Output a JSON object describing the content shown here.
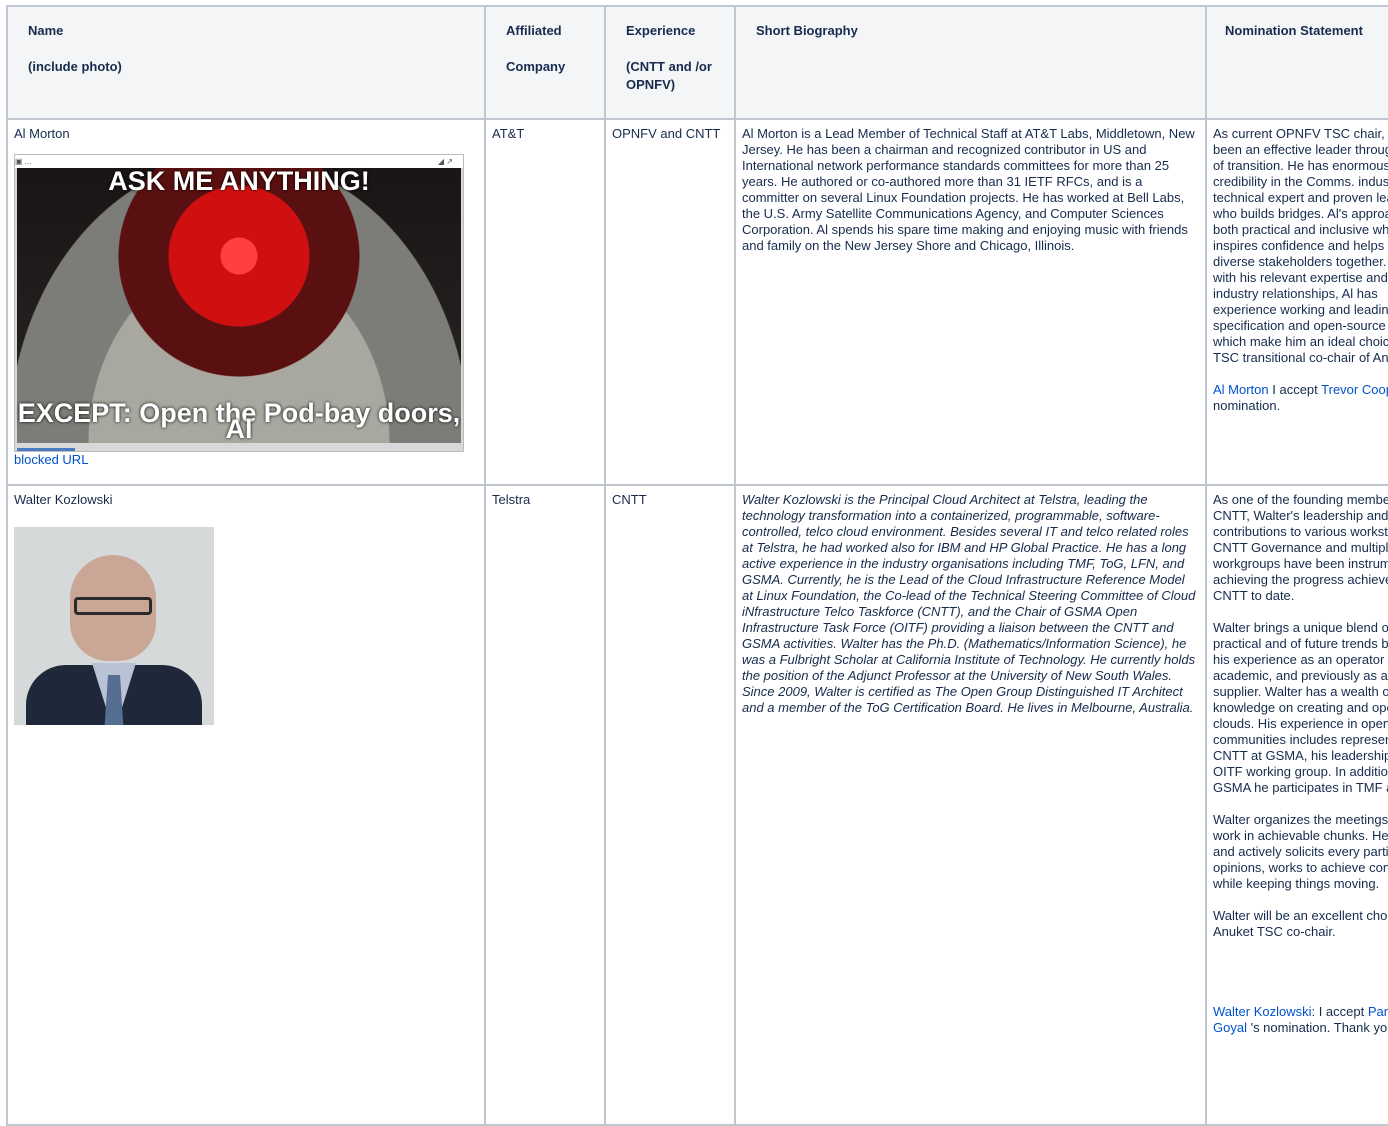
{
  "headers": {
    "name": [
      "Name",
      "(include photo)"
    ],
    "company": [
      "Affiliated",
      "Company"
    ],
    "experience": [
      "Experience",
      "(CNTT and /or OPNFV)"
    ],
    "bio": [
      "Short Biography"
    ],
    "nomination": [
      "Nomination Statement"
    ]
  },
  "rows": [
    {
      "name": "Al Morton",
      "company": "AT&T",
      "experience": "OPNFV and CNTT",
      "photo_caption_top": "ASK ME ANYTHING!",
      "photo_caption_bottom": "EXCEPT: Open the Pod-bay doors, Al",
      "photo_link": "blocked URL",
      "bio": "Al Morton is a Lead Member of Technical Staff at AT&T Labs, Middletown, New Jersey. He has been a chairman and recognized contributor in US and International network performance standards committees for more than 25 years. He authored or co-authored more than 31 IETF RFCs, and is a committer on several Linux Foundation projects. He has worked at Bell Labs, the U.S. Army Satellite Communications Agency, and Computer Sciences Corporation. Al spends his spare time making and enjoying music with friends and family on the New Jersey Shore and Chicago, Illinois.",
      "nomination": [
        "As current OPNFV TSC chair, Al has been an effective leader through a time of transition. He has enormous credibility in the Comms. industry as a technical expert and proven leader who builds bridges. Al's approach is both practical and inclusive which inspires confidence and helps bring diverse stakeholders together. Along with his relevant expertise and key industry relationships, Al has experience working and leading in both specification and open-source bodies which make him an ideal choice for TSC transitional co-chair of Anuket."
      ],
      "accept": {
        "nominee": "Al Morton",
        "text_mid": " I accept ",
        "nominator": "Trevor Cooper",
        "text_end": " 's nomination."
      }
    },
    {
      "name": "Walter Kozlowski",
      "company": "Telstra",
      "experience": "CNTT",
      "bio": "Walter Kozlowski is the Principal Cloud Architect at Telstra, leading the technology transformation into a containerized, programmable, software-controlled,  telco cloud environment. Besides several IT and telco related roles at Telstra, he had worked also for IBM and HP Global Practice. He has  a long active experience in the industry organisations including TMF, ToG, LFN, and GSMA. Currently, he is the Lead of the Cloud Infrastructure Reference Model at Linux Foundation, the Co-lead of the Technical Steering Committee of Cloud iNfrastructure Telco Taskforce (CNTT), and the Chair of GSMA Open Infrastructure Task Force (OITF) providing a liaison between the CNTT and GSMA activities. Walter has the Ph.D. (Mathematics/Information Science), he was a Fulbright Scholar at California Institute of Technology. He  currently holds the position of the Adjunct Professor at the University of New South Wales.  Since 2009, Walter is certified as The Open Group Distinguished IT Architect and a member of the ToG Certification Board. He lives in Melbourne, Australia.",
      "nomination": [
        "As one of the founding members of CNTT, Walter's leadership and contributions to various workstreams, CNTT Governance and multiple ad hoc workgroups have been instrumental in achieving the progress achieved by CNTT to date.",
        "Walter brings a unique blend of practical and of future trends based on his experience as an operator and an academic, and previously as a supplier. Walter has a wealth of knowledge on creating and operating clouds. His experience in open-source communities includes representing CNTT at GSMA, his leadership of the OITF working group. In addition to GSMA he participates in TMF and ToG.",
        "Walter organizes the meetings and work in achievable chunks. He ensures and actively solicits every participants opinions, works to achieve consensus, while keeping things moving.",
        "Walter will be an excellent choice for Anuket TSC co-chair."
      ],
      "accept": {
        "nominee": "Walter Kozlowski",
        "text_mid": ": I accept ",
        "nominator": "Pankaj Goyal",
        "text_end": " 's nomination. Thank you."
      }
    }
  ]
}
